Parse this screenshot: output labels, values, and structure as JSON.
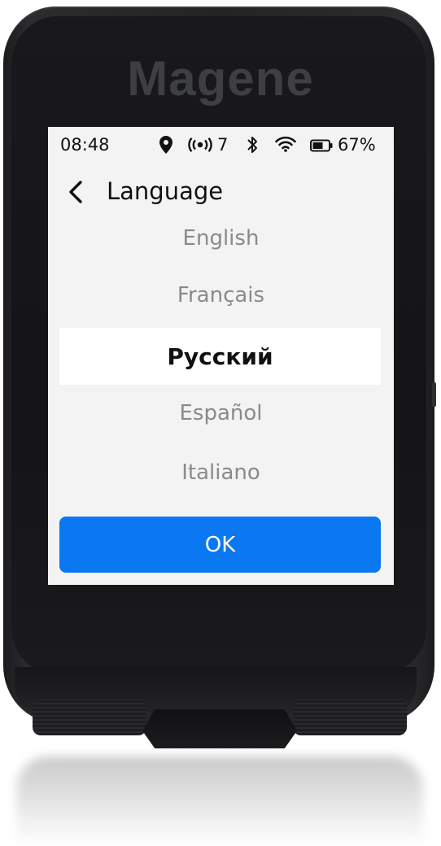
{
  "brand": "Magene",
  "status_bar": {
    "time": "08:48",
    "gps_satellites": "7",
    "battery_percent": "67%",
    "icons": [
      "location-icon",
      "satellite-signal-icon",
      "bluetooth-icon",
      "wifi-icon",
      "battery-icon"
    ]
  },
  "header": {
    "title": "Language",
    "back_icon": "chevron-left-icon"
  },
  "languages": {
    "items": [
      "English",
      "Français",
      "Русский",
      "Español",
      "Italiano"
    ],
    "selected": "Русский"
  },
  "ok_button": {
    "label": "OK"
  },
  "colors": {
    "accent": "#0a78f0",
    "screen_bg": "#f3f3f3",
    "selected_bg": "#ffffff",
    "unselected_text": "#8a8a8a",
    "device_body": "#1e1e20"
  }
}
